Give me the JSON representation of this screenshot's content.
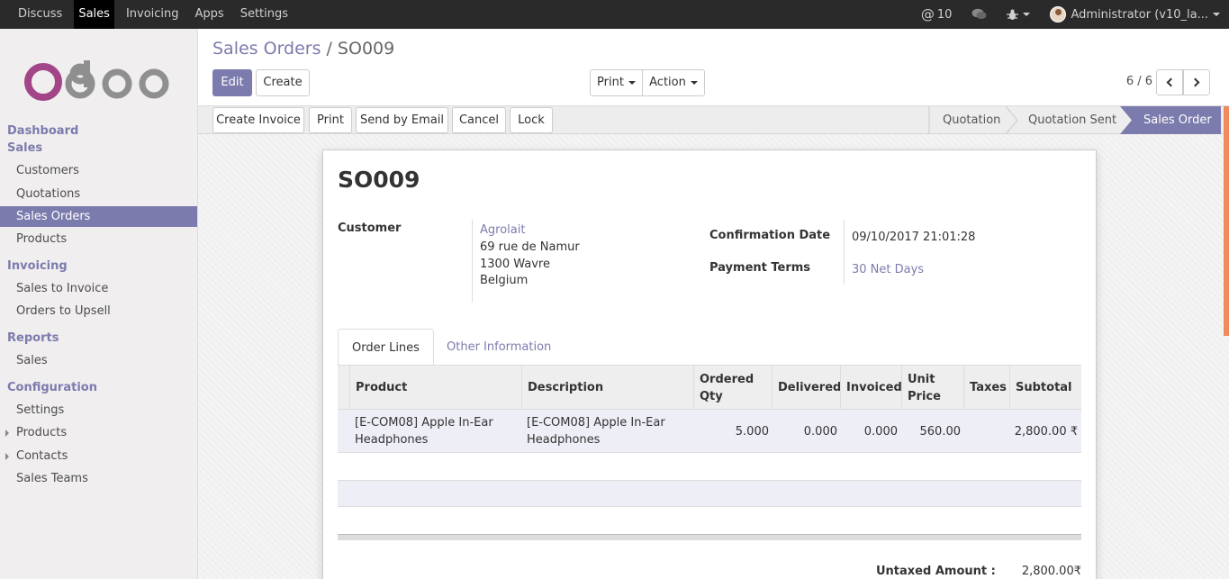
{
  "topbar": {
    "menu": [
      "Discuss",
      "Sales",
      "Invoicing",
      "Apps",
      "Settings"
    ],
    "active": "Sales",
    "mentions": "10",
    "user": "Administrator (v10_la..."
  },
  "sidebar": {
    "sections": [
      {
        "title": "Dashboard"
      },
      {
        "title": "Sales",
        "items": [
          "Customers",
          "Quotations",
          "Sales Orders",
          "Products"
        ]
      },
      {
        "title": "Invoicing",
        "items": [
          "Sales to Invoice",
          "Orders to Upsell"
        ]
      },
      {
        "title": "Reports",
        "items": [
          "Sales"
        ]
      },
      {
        "title": "Configuration",
        "items": [
          "Settings",
          "Products",
          "Contacts",
          "Sales Teams"
        ]
      }
    ],
    "active_item": "Sales Orders"
  },
  "breadcrumb": {
    "parent": "Sales Orders",
    "separator": "/",
    "current": "SO009"
  },
  "buttons": {
    "edit": "Edit",
    "create": "Create",
    "print": "Print",
    "action": "Action"
  },
  "pager": "6 / 6",
  "statusbar": {
    "buttons": [
      "Create Invoice",
      "Print",
      "Send by Email",
      "Cancel",
      "Lock"
    ],
    "stages": [
      "Quotation",
      "Quotation Sent",
      "Sales Order"
    ],
    "active_stage": "Sales Order"
  },
  "order": {
    "name": "SO009",
    "customer_label": "Customer",
    "customer_name": "Agrolait",
    "address": [
      "69 rue de Namur",
      "1300 Wavre",
      "Belgium"
    ],
    "confirmation_label": "Confirmation Date",
    "confirmation_date": "09/10/2017 21:01:28",
    "payment_label": "Payment Terms",
    "payment_terms": "30 Net Days"
  },
  "tabs": [
    "Order Lines",
    "Other Information"
  ],
  "lines": {
    "headers": [
      "Product",
      "Description",
      "Ordered Qty",
      "Delivered",
      "Invoiced",
      "Unit Price",
      "Taxes",
      "Subtotal"
    ],
    "rows": [
      {
        "product": "[E-COM08] Apple In-Ear Headphones",
        "description": "[E-COM08] Apple In-Ear Headphones",
        "ordered": "5.000",
        "delivered": "0.000",
        "invoiced": "0.000",
        "unit_price": "560.00",
        "taxes": "",
        "subtotal": "2,800.00 ₹"
      }
    ]
  },
  "totals": {
    "untaxed_label": "Untaxed Amount :",
    "untaxed_value": "2,800.00₹"
  },
  "colors": {
    "brand": "#7c7bad",
    "topbar": "#2a2a2a",
    "logo_o": "#a24689",
    "logo_doo": "#8f8f8f"
  }
}
